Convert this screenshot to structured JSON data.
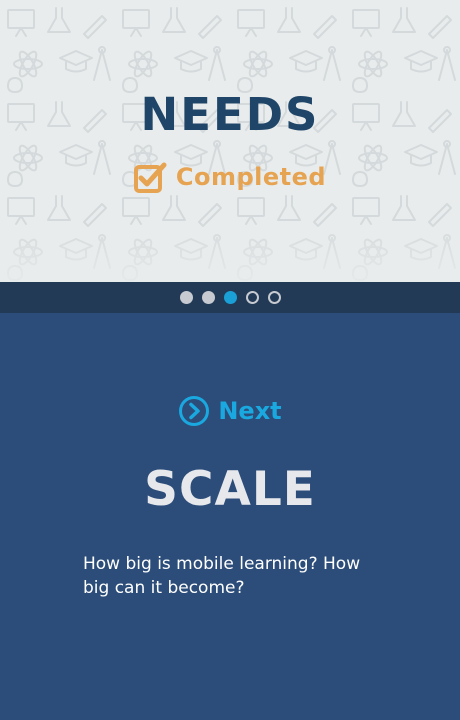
{
  "hero": {
    "title": "NEEDS",
    "status_icon": "checkbox-checked-icon",
    "status_label": "Completed",
    "status_color": "#e6a352",
    "title_color": "#1f4568"
  },
  "pager": {
    "dots": [
      "filled",
      "filled",
      "active",
      "empty",
      "empty"
    ],
    "active_color": "#1aa0d6"
  },
  "next": {
    "icon": "chevron-right-circle-icon",
    "label": "Next",
    "color": "#1aa8e0"
  },
  "section": {
    "title": "SCALE",
    "description": "How big is mobile learning? How big can it become?",
    "background": "#2c4d79"
  }
}
